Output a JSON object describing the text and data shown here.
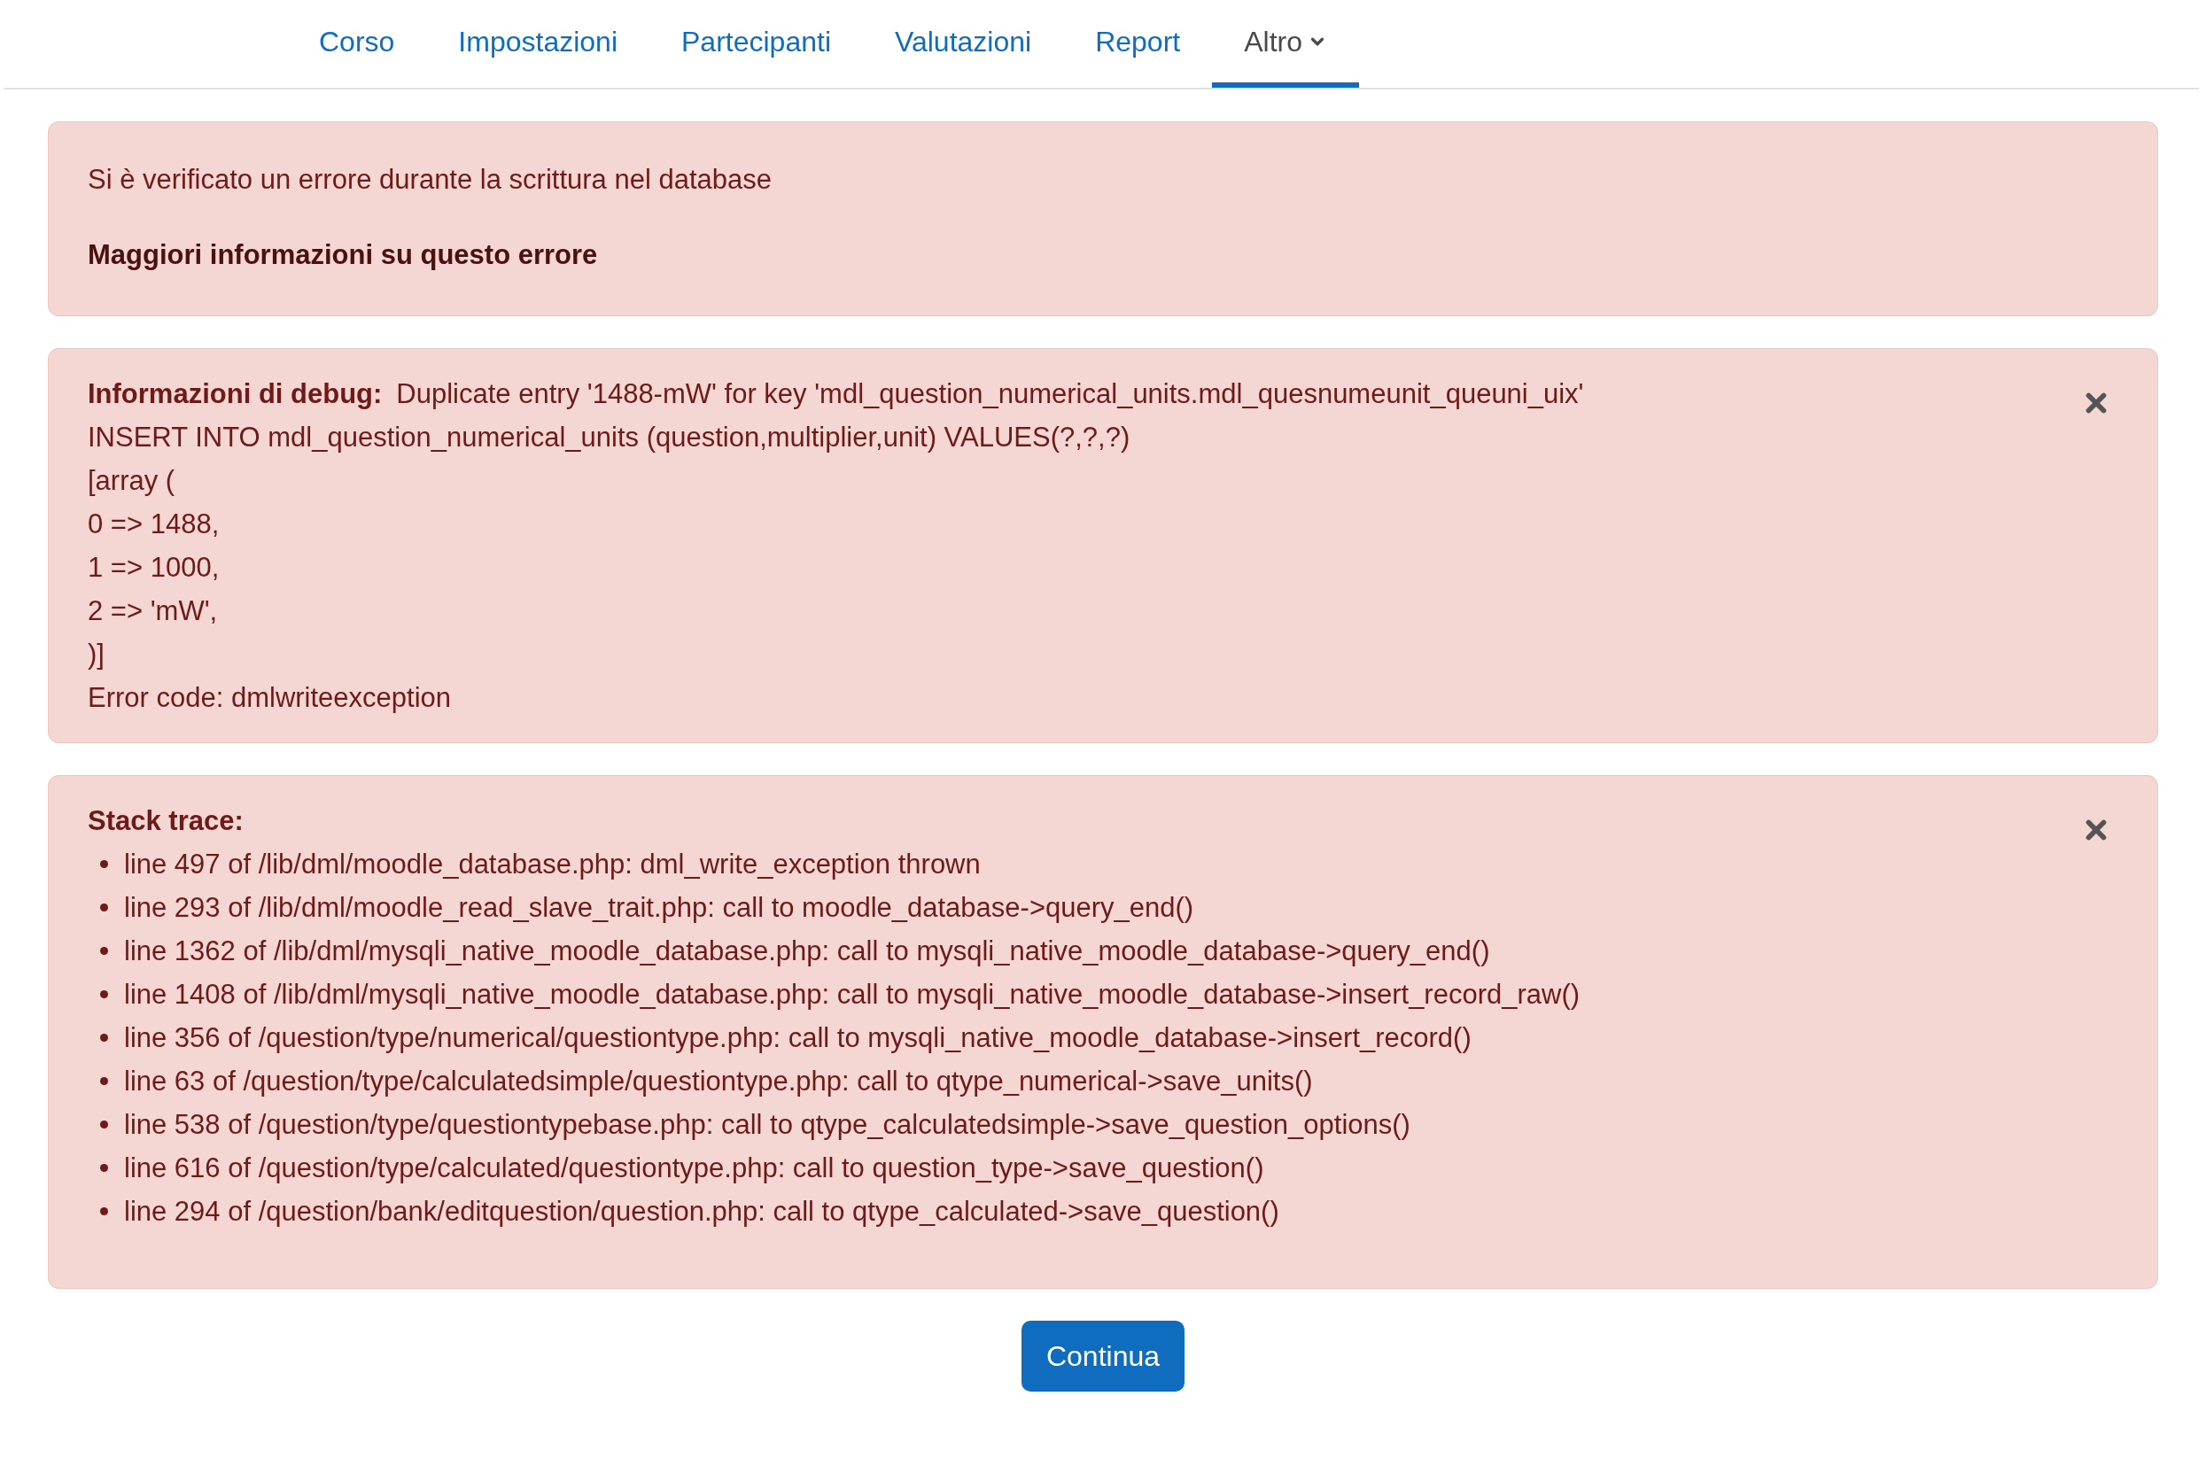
{
  "nav": {
    "tabs": [
      {
        "label": "Corso",
        "selected": false,
        "kind": "link"
      },
      {
        "label": "Impostazioni",
        "selected": false,
        "kind": "link"
      },
      {
        "label": "Partecipanti",
        "selected": false,
        "kind": "link"
      },
      {
        "label": "Valutazioni",
        "selected": false,
        "kind": "link"
      },
      {
        "label": "Report",
        "selected": false,
        "kind": "link"
      },
      {
        "label": "Altro",
        "selected": true,
        "kind": "dropdown"
      }
    ]
  },
  "error_alert": {
    "message": "Si è verificato un errore durante la scrittura nel database",
    "more_info": "Maggiori informazioni su questo errore"
  },
  "debug_alert": {
    "label": "Informazioni di debug:",
    "message": "Duplicate entry '1488-mW' for key 'mdl_question_numerical_units.mdl_quesnumeunit_queuni_uix'",
    "lines": [
      "INSERT INTO mdl_question_numerical_units (question,multiplier,unit) VALUES(?,?,?)",
      "[array (",
      "0 => 1488,",
      "1 => 1000,",
      "2 => 'mW',",
      ")]",
      "Error code: dmlwriteexception"
    ]
  },
  "stack_trace": {
    "label": "Stack trace:",
    "items": [
      "line 497 of /lib/dml/moodle_database.php: dml_write_exception thrown",
      "line 293 of /lib/dml/moodle_read_slave_trait.php: call to moodle_database->query_end()",
      "line 1362 of /lib/dml/mysqli_native_moodle_database.php: call to mysqli_native_moodle_database->query_end()",
      "line 1408 of /lib/dml/mysqli_native_moodle_database.php: call to mysqli_native_moodle_database->insert_record_raw()",
      "line 356 of /question/type/numerical/questiontype.php: call to mysqli_native_moodle_database->insert_record()",
      "line 63 of /question/type/calculatedsimple/questiontype.php: call to qtype_numerical->save_units()",
      "line 538 of /question/type/questiontypebase.php: call to qtype_calculatedsimple->save_question_options()",
      "line 616 of /question/type/calculated/questiontype.php: call to question_type->save_question()",
      "line 294 of /question/bank/editquestion/question.php: call to qtype_calculated->save_question()"
    ]
  },
  "continue_button": "Continua"
}
